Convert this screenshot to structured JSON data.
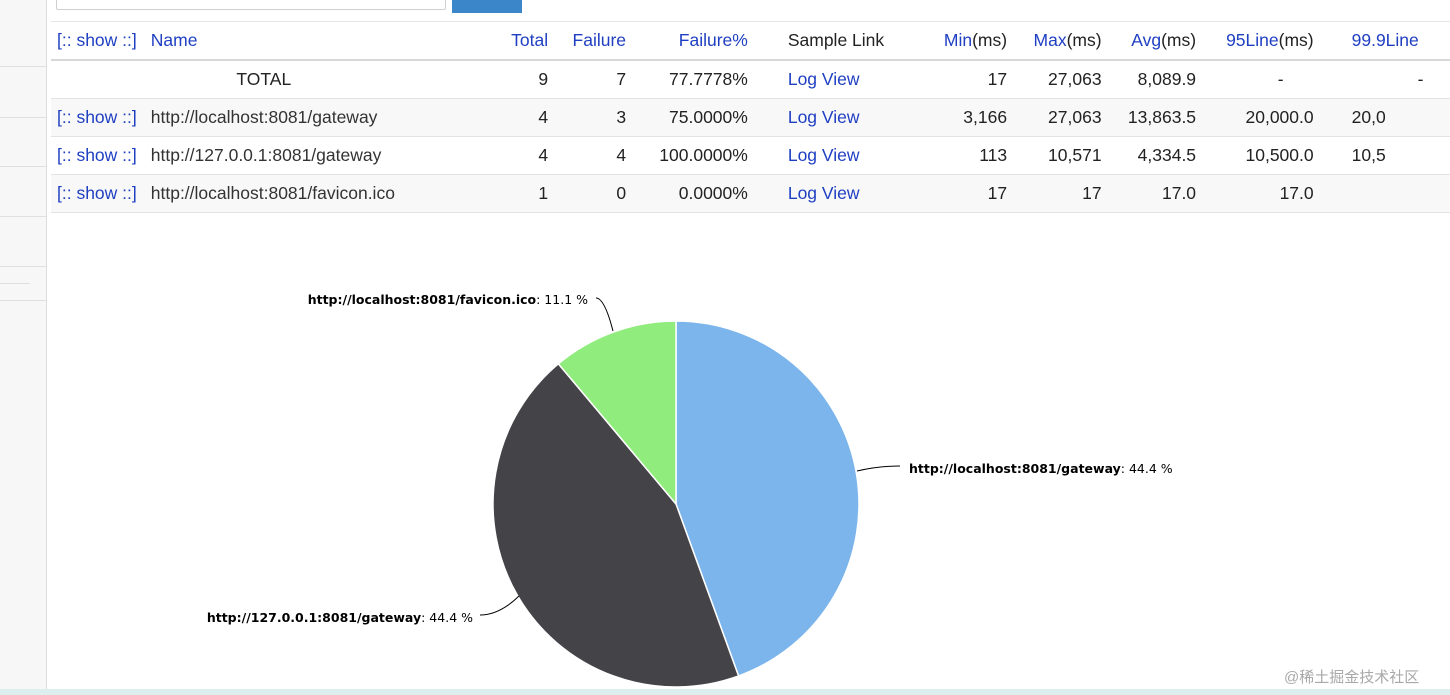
{
  "top_note": "",
  "table": {
    "headers": {
      "show": "[:: show ::]",
      "name": "Name",
      "total": "Total",
      "failure": "Failure",
      "failure_pct": "Failure%",
      "sample_link": "Sample Link",
      "min_link": "Min",
      "min_unit": "(ms)",
      "max_link": "Max",
      "max_unit": "(ms)",
      "avg_link": "Avg",
      "avg_unit": "(ms)",
      "line95_link": "95Line",
      "line95_unit": "(ms)",
      "line999_link": "99.9Line"
    },
    "total_row": {
      "name": "TOTAL",
      "total": "9",
      "failure": "7",
      "failure_pct": "77.7778%",
      "sample": "Log View",
      "min": "17",
      "max": "27,063",
      "avg": "8,089.9",
      "line95": "-",
      "line999": "-"
    },
    "rows": [
      {
        "show": "[:: show ::]",
        "name": "http://localhost:8081/gateway",
        "total": "4",
        "failure": "3",
        "failure_pct": "75.0000%",
        "sample": "Log View",
        "min": "3,166",
        "max": "27,063",
        "avg": "13,863.5",
        "line95": "20,000.0",
        "line999": "20,0"
      },
      {
        "show": "[:: show ::]",
        "name": "http://127.0.0.1:8081/gateway",
        "total": "4",
        "failure": "4",
        "failure_pct": "100.0000%",
        "sample": "Log View",
        "min": "113",
        "max": "10,571",
        "avg": "4,334.5",
        "line95": "10,500.0",
        "line999": "10,5"
      },
      {
        "show": "[:: show ::]",
        "name": "http://localhost:8081/favicon.ico",
        "total": "1",
        "failure": "0",
        "failure_pct": "0.0000%",
        "sample": "Log View",
        "min": "17",
        "max": "17",
        "avg": "17.0",
        "line95": "17.0",
        "line999": ""
      }
    ]
  },
  "chart_data": {
    "type": "pie",
    "title": "",
    "slices": [
      {
        "label": "http://localhost:8081/gateway",
        "value": 44.4,
        "color": "#7cb5ec",
        "label_text": "44.4 %"
      },
      {
        "label": "http://127.0.0.1:8081/gateway",
        "value": 44.4,
        "color": "#434348",
        "label_text": "44.4 %"
      },
      {
        "label": "http://localhost:8081/favicon.ico",
        "value": 11.1,
        "color": "#90ed7d",
        "label_text": "11.1 %"
      }
    ]
  },
  "watermark": "@稀土掘金技术社区"
}
